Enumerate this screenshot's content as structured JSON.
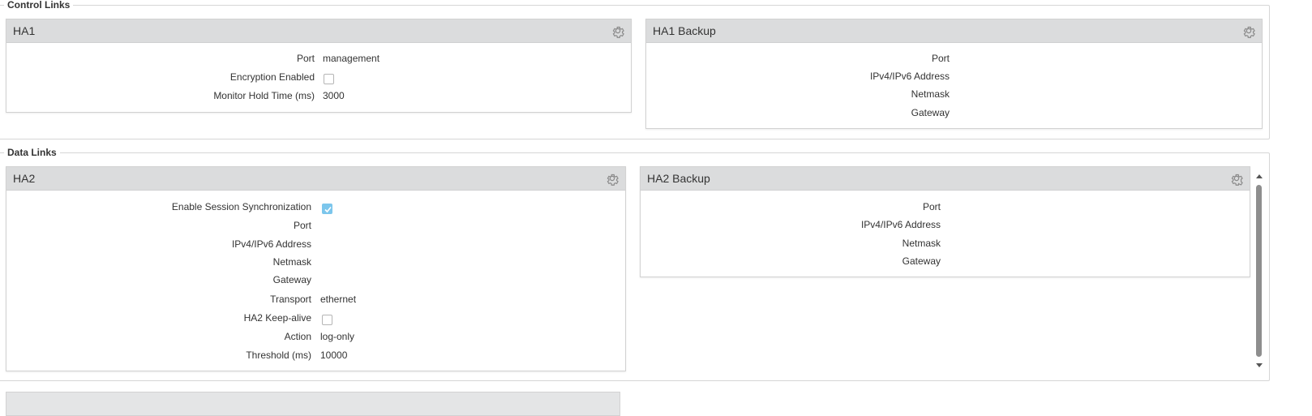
{
  "control_links": {
    "legend": "Control Links",
    "ha1": {
      "title": "HA1",
      "rows": [
        {
          "label": "Port",
          "value": "management"
        },
        {
          "label": "Encryption Enabled",
          "checked": false
        },
        {
          "label": "Monitor Hold Time (ms)",
          "value": "3000"
        }
      ]
    },
    "ha1_backup": {
      "title": "HA1 Backup",
      "rows": [
        {
          "label": "Port"
        },
        {
          "label": "IPv4/IPv6 Address"
        },
        {
          "label": "Netmask"
        },
        {
          "label": "Gateway"
        }
      ]
    }
  },
  "data_links": {
    "legend": "Data Links",
    "ha2": {
      "title": "HA2",
      "rows": [
        {
          "label": "Enable Session Synchronization",
          "checked": true
        },
        {
          "label": "Port"
        },
        {
          "label": "IPv4/IPv6 Address"
        },
        {
          "label": "Netmask"
        },
        {
          "label": "Gateway"
        },
        {
          "label": "Transport",
          "value": "ethernet"
        },
        {
          "label": "HA2 Keep-alive",
          "checked": false
        },
        {
          "label": "Action",
          "value": "log-only"
        },
        {
          "label": "Threshold (ms)",
          "value": "10000"
        }
      ]
    },
    "ha2_backup": {
      "title": "HA2 Backup",
      "rows": [
        {
          "label": "Port"
        },
        {
          "label": "IPv4/IPv6 Address"
        },
        {
          "label": "Netmask"
        },
        {
          "label": "Gateway"
        }
      ]
    }
  },
  "icons": {
    "panel_settings": "gear-icon",
    "scroll_up": "triangle-up",
    "scroll_down": "triangle-down"
  },
  "colors": {
    "panel_header_bg": "#dbdcdd",
    "checkbox_checked": "#7cc6ec",
    "border": "#d2d2d2"
  }
}
